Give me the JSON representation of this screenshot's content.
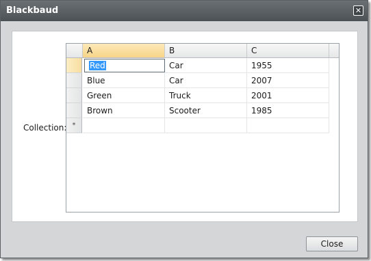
{
  "window": {
    "title": "Blackbaud"
  },
  "form": {
    "collection_label": "Collection:"
  },
  "grid": {
    "columns": [
      "A",
      "B",
      "C"
    ],
    "rows": [
      [
        "Red",
        "Car",
        "1955"
      ],
      [
        "Blue",
        "Car",
        "2007"
      ],
      [
        "Green",
        "Truck",
        "2001"
      ],
      [
        "Brown",
        "Scooter",
        "1985"
      ]
    ],
    "new_row_marker": "*"
  },
  "footer": {
    "close_label": "Close"
  },
  "icons": {
    "close": "close-icon"
  }
}
